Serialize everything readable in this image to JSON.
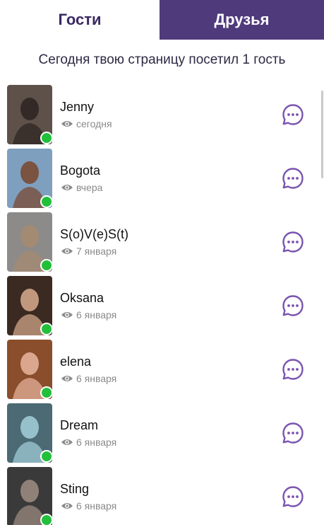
{
  "tabs": {
    "guests": "Гости",
    "friends": "Друзья"
  },
  "visits_text": "Сегодня твою страницу посетил 1 гость",
  "colors": {
    "accent": "#4f3a7c",
    "online": "#22c03a",
    "icon": "#7a55b0"
  },
  "guests": [
    {
      "name": "Jenny",
      "seen": "сегодня",
      "online": true,
      "bg": "#5e5149",
      "fg": "#2f2623"
    },
    {
      "name": "Bogota",
      "seen": "вчера",
      "online": true,
      "bg": "#7f9fbf",
      "fg": "#7a4a33"
    },
    {
      "name": "S(o)V(e)S(t)",
      "seen": "7 января",
      "online": true,
      "bg": "#8d8a8a",
      "fg": "#a58a70"
    },
    {
      "name": "Oksana",
      "seen": "6 января",
      "online": true,
      "bg": "#3a2a22",
      "fg": "#d0a488"
    },
    {
      "name": "elena",
      "seen": "6 января",
      "online": true,
      "bg": "#8a4e2c",
      "fg": "#e2b098"
    },
    {
      "name": "Dream",
      "seen": "6 января",
      "online": true,
      "bg": "#4b6a73",
      "fg": "#9fcbd6"
    },
    {
      "name": "Sting",
      "seen": "6 января",
      "online": true,
      "bg": "#3a3a3a",
      "fg": "#9a8a80"
    }
  ]
}
